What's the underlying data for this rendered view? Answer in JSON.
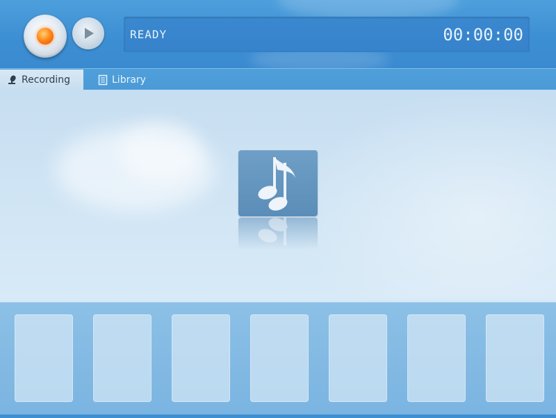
{
  "header": {
    "status": "READY",
    "timer": "00:00:00"
  },
  "tabs": [
    {
      "label": "Recording",
      "icon": "microphone-icon",
      "active": true
    },
    {
      "label": "Library",
      "icon": "book-icon",
      "active": false
    }
  ],
  "main": {
    "center_icon": "music-note-icon"
  },
  "slots": {
    "count": 7
  },
  "colors": {
    "header_bg": "#3d8fd3",
    "record_accent": "#ff8a1a",
    "panel_bg": "#cfe4f4"
  }
}
